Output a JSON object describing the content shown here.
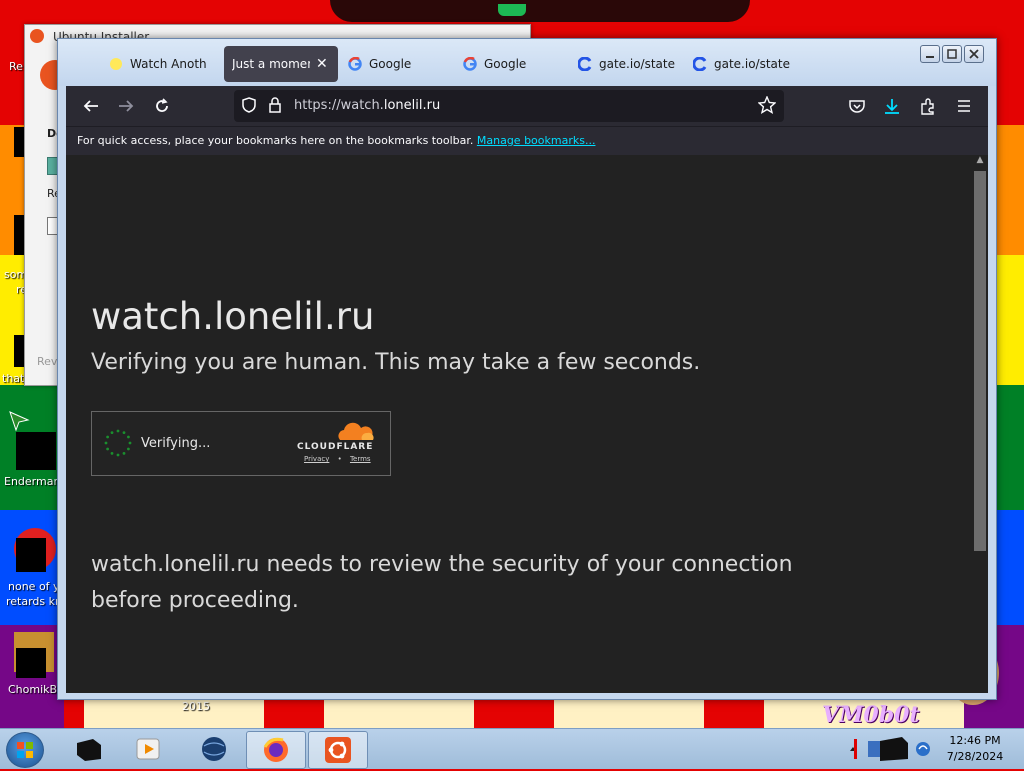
{
  "desktop": {
    "icons": [
      {
        "label": "Re"
      },
      {
        "label": "som"
      },
      {
        "label": "re"
      },
      {
        "label": "that"
      },
      {
        "label": "Enderman"
      },
      {
        "label": "none of y"
      },
      {
        "label": "retards kn"
      },
      {
        "label": "ChomikB"
      }
    ],
    "watermark": "VM0b0t",
    "year_label": "2015"
  },
  "installer": {
    "title": "Ubuntu Installer",
    "partial_labels": [
      "Do",
      "Re",
      "Rev"
    ]
  },
  "browser": {
    "tabs": [
      {
        "label": "Watch Anoth",
        "icon": "sun-favicon",
        "active": false
      },
      {
        "label": "Just a moment",
        "icon": "",
        "active": true
      },
      {
        "label": "Google",
        "icon": "google-g-favicon",
        "active": false
      },
      {
        "label": "Google",
        "icon": "google-g-favicon",
        "active": false
      },
      {
        "label": "gate.io/state",
        "icon": "gate-favicon",
        "active": false
      },
      {
        "label": "gate.io/state",
        "icon": "gate-favicon",
        "active": false
      }
    ],
    "close_tab_glyph": "✕",
    "url_prefix": "https://watch.",
    "url_domain": "lonelil.ru",
    "bookmarks_hint": "For quick access, place your bookmarks here on the bookmarks toolbar.",
    "manage_bookmarks": "Manage bookmarks..."
  },
  "page": {
    "title": "watch.lonelil.ru",
    "subtitle": "Verifying you are human. This may take a few seconds.",
    "widget": {
      "status": "Verifying...",
      "brand": "CLOUDFLARE",
      "privacy": "Privacy",
      "separator": "•",
      "terms": "Terms"
    },
    "review_text": "watch.lonelil.ru needs to review the security of your connection before proceeding."
  },
  "taskbar": {
    "time": "12:46 PM",
    "date": "7/28/2024"
  },
  "colors": {
    "content_bg": "#222222",
    "navbar_bg": "#2b2a33",
    "link": "#00ddff",
    "cloudflare_orange": "#f38020",
    "spinner_green": "#1a8f2e"
  }
}
